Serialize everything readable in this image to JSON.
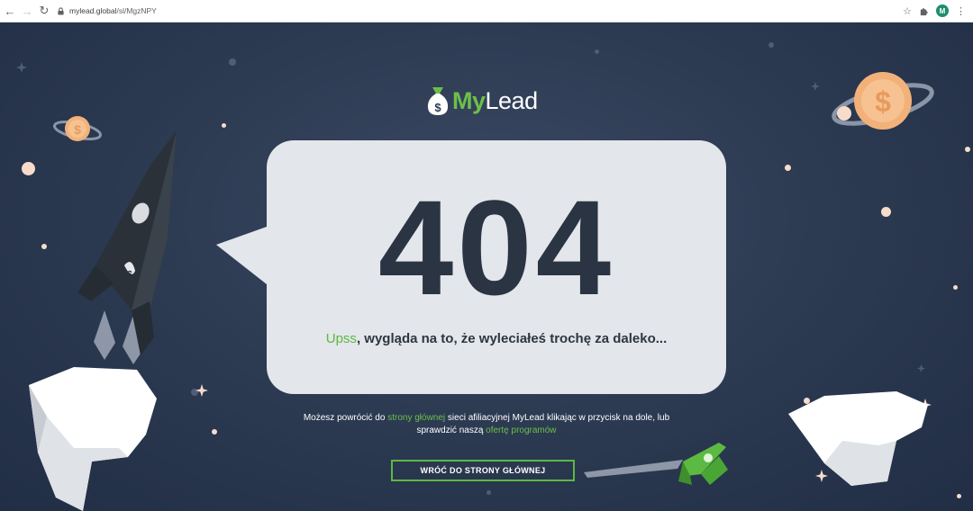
{
  "browser": {
    "url_host": "mylead.global",
    "url_path": "/sl/MgzNPY",
    "profile_initial": "M"
  },
  "logo": {
    "part1": "My",
    "part2": "Lead"
  },
  "error": {
    "code": "404",
    "message_highlight": "Upss",
    "message_rest": ", wygląda na to, że wyleciałeś trochę za daleko..."
  },
  "info": {
    "text1": "Możesz powrócić do ",
    "link1": "strony głównej",
    "text2": " sieci afiliacyjnej MyLead klikając w przycisk na dole, lub",
    "text3": "sprawdzić naszą ",
    "link2": "ofertę programów"
  },
  "button": {
    "label": "WRÓĆ DO STRONY GŁÓWNEJ"
  },
  "colors": {
    "accent": "#6cc04a",
    "background": "#2d3b53",
    "bubble": "#e3e6ea",
    "planet": "#f3b17a"
  },
  "icons": {
    "back": "arrow-left-icon",
    "forward": "arrow-right-icon",
    "reload": "reload-icon",
    "lock": "lock-icon",
    "star": "bookmark-star-icon",
    "extensions": "puzzle-icon",
    "menu": "kebab-menu-icon",
    "logo": "money-bag-icon"
  }
}
